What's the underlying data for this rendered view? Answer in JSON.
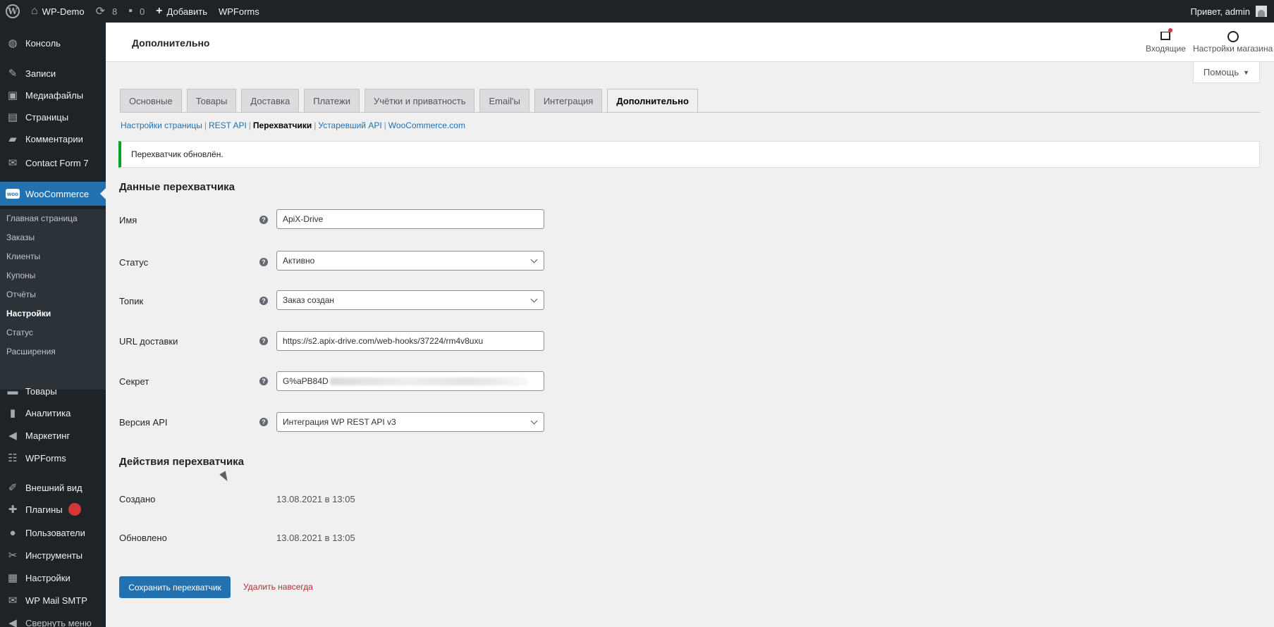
{
  "admin_bar": {
    "site_name": "WP-Demo",
    "updates_count": "8",
    "comments_count": "0",
    "add_label": "Добавить",
    "wpforms_label": "WPForms",
    "greeting": "Привет, admin"
  },
  "sidebar": {
    "items": [
      {
        "label": "Консоль",
        "icon": "dashboard-icon"
      },
      {
        "label": "Записи",
        "icon": "pin-icon"
      },
      {
        "label": "Медиафайлы",
        "icon": "media-icon"
      },
      {
        "label": "Страницы",
        "icon": "page-icon"
      },
      {
        "label": "Комментарии",
        "icon": "comment-icon"
      },
      {
        "label": "Contact Form 7",
        "icon": "mail-icon"
      },
      {
        "label": "WooCommerce",
        "icon": "woocommerce-icon"
      },
      {
        "label": "Товары",
        "icon": "archive-icon"
      },
      {
        "label": "Аналитика",
        "icon": "chart-icon"
      },
      {
        "label": "Маркетинг",
        "icon": "megaphone-icon"
      },
      {
        "label": "WPForms",
        "icon": "form-icon"
      },
      {
        "label": "Внешний вид",
        "icon": "brush-icon"
      },
      {
        "label": "Плагины",
        "icon": "plugin-icon"
      },
      {
        "label": "Пользователи",
        "icon": "users-icon"
      },
      {
        "label": "Инструменты",
        "icon": "wrench-icon"
      },
      {
        "label": "Настройки",
        "icon": "settings-icon"
      },
      {
        "label": "WP Mail SMTP",
        "icon": "mail-smtp-icon"
      },
      {
        "label": "Свернуть меню",
        "icon": "collapse-icon"
      }
    ],
    "woocommerce_submenu": [
      "Главная страница",
      "Заказы",
      "Клиенты",
      "Купоны",
      "Отчёты",
      "Настройки",
      "Статус",
      "Расширения"
    ]
  },
  "header": {
    "title": "Дополнительно",
    "inbox_label": "Входящие",
    "store_setup_label": "Настройки магазина",
    "help_label": "Помощь"
  },
  "tabs": [
    "Основные",
    "Товары",
    "Доставка",
    "Платежи",
    "Учётки и приватность",
    "Email'ы",
    "Интеграция",
    "Дополнительно"
  ],
  "subsub": {
    "page_setup": "Настройки страницы",
    "rest_api": "REST API",
    "webhooks": "Перехватчики",
    "legacy_api": "Устаревший API",
    "woocommerce_com": "WooCommerce.com"
  },
  "notice": "Перехватчик обновлён.",
  "webhook_data": {
    "title": "Данные перехватчика",
    "name_label": "Имя",
    "name_value": "ApiX-Drive",
    "status_label": "Статус",
    "status_value": "Активно",
    "topic_label": "Топик",
    "topic_value": "Заказ создан",
    "url_label": "URL доставки",
    "url_value": "https://s2.apix-drive.com/web-hooks/37224/rm4v8uxu",
    "secret_label": "Секрет",
    "secret_value": "G%aPB84D",
    "api_version_label": "Версия API",
    "api_version_value": "Интеграция WP REST API v3"
  },
  "webhook_actions": {
    "title": "Действия перехватчика",
    "created_label": "Создано",
    "created_value": "13.08.2021 в 13:05",
    "updated_label": "Обновлено",
    "updated_value": "13.08.2021 в 13:05"
  },
  "buttons": {
    "save": "Сохранить перехватчик",
    "delete": "Удалить навсегда"
  },
  "colors": {
    "admin_dark": "#1d2327",
    "accent_blue": "#2271b1",
    "success_green": "#00a32a",
    "danger_red": "#b32d2e"
  }
}
